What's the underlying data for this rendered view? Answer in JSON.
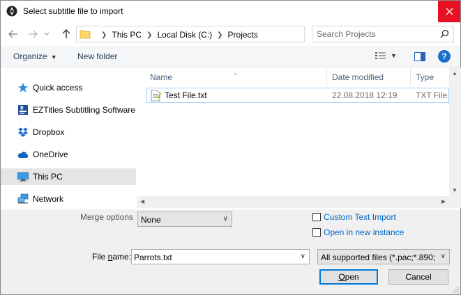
{
  "window": {
    "title": "Select subtitle file to import"
  },
  "navigation": {
    "breadcrumbs": [
      "This PC",
      "Local Disk (C:)",
      "Projects"
    ],
    "search_placeholder": "Search Projects"
  },
  "toolbar": {
    "organize_label": "Organize",
    "new_folder_label": "New folder",
    "help_label": "?"
  },
  "sidebar": {
    "items": [
      {
        "label": "Quick access",
        "icon": "star-icon"
      },
      {
        "label": "EZTitles Subtitling Software",
        "icon": "eztitles-icon"
      },
      {
        "label": "Dropbox",
        "icon": "dropbox-icon"
      },
      {
        "label": "OneDrive",
        "icon": "cloud-icon"
      },
      {
        "label": "This PC",
        "icon": "computer-icon",
        "selected": true
      },
      {
        "label": "Network",
        "icon": "network-icon"
      }
    ]
  },
  "file_list": {
    "columns": [
      "Name",
      "Date modified",
      "Type"
    ],
    "files": [
      {
        "name": "Test File.txt",
        "date_modified": "22.08.2018 12:19",
        "type": "TXT File"
      }
    ]
  },
  "options": {
    "merge_label": "Merge options",
    "merge_value": "None",
    "custom_text_import_label": "Custom Text Import",
    "open_new_instance_label": "Open in new instance"
  },
  "file_name": {
    "label_prefix": "File ",
    "label_underlined": "n",
    "label_suffix": "ame:",
    "value": "Parrots.txt"
  },
  "file_type": {
    "value": "All supported files (*.pac;*.890;*"
  },
  "buttons": {
    "open_underlined": "O",
    "open_rest": "pen",
    "cancel_label": "Cancel"
  },
  "colors": {
    "close_button": "#e81123",
    "accent": "#0078d7",
    "link": "#0066cc",
    "selection_border": "#99d1ff"
  }
}
